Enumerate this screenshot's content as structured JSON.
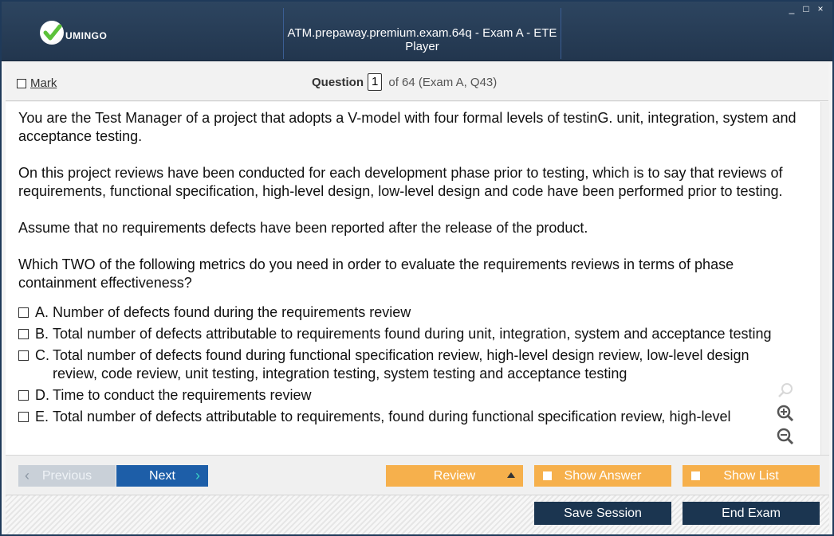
{
  "app": {
    "logo_text": "UMINGO",
    "window_title": "ATM.prepaway.premium.exam.64q - Exam A - ETE Player",
    "controls": {
      "minimize": "_",
      "maximize": "□",
      "close": "×"
    }
  },
  "header": {
    "mark_label": "Mark",
    "question_label": "Question",
    "question_number": "1",
    "question_of": "of 64 (Exam A, Q43)"
  },
  "question": {
    "paragraphs": [
      "You are the Test Manager of a project that adopts a V-model with four formal levels of testinG. unit, integration, system and acceptance testing.",
      "On this project reviews have been conducted for each development phase prior to testing, which is to say that reviews of requirements, functional specification, high-level design, low-level design and code have been performed prior to testing.",
      "Assume that no requirements defects have been reported after the release of the product.",
      "Which TWO of the following metrics do you need in order to evaluate the requirements reviews in terms of phase containment effectiveness?"
    ],
    "options": [
      {
        "letter": "A.",
        "text": "Number of defects found during the requirements review"
      },
      {
        "letter": "B.",
        "text": "Total number of defects attributable to requirements found during unit, integration, system and acceptance testing"
      },
      {
        "letter": "C.",
        "text": "Total number of defects found during functional specification review, high-level design review, low-level design review, code review, unit testing, integration testing, system testing and acceptance testing"
      },
      {
        "letter": "D.",
        "text": "Time to conduct the requirements review"
      },
      {
        "letter": "E.",
        "text": "Total number of defects attributable to requirements, found during functional specification review, high-level"
      }
    ]
  },
  "nav": {
    "previous": "Previous",
    "next": "Next",
    "review": "Review",
    "show_answer": "Show Answer",
    "show_list": "Show List"
  },
  "footer": {
    "save_session": "Save Session",
    "end_exam": "End Exam"
  },
  "colors": {
    "titlebar": "#22364e",
    "next_button": "#1d5ea8",
    "orange_button": "#f6b04c",
    "footer_button": "#1b3550"
  }
}
